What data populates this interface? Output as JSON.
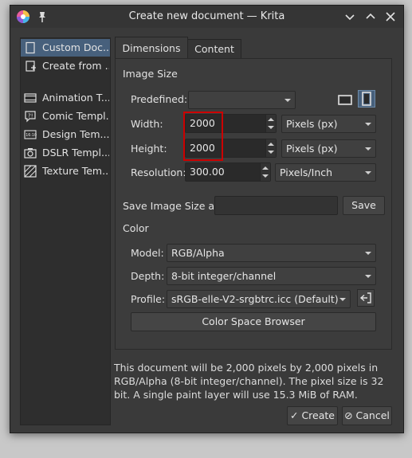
{
  "window": {
    "title": "Create new document — Krita",
    "app_icon": "krita-icon",
    "pin_icon": "pin-icon",
    "controls": [
      "minimize-icon",
      "maximize-icon",
      "close-icon"
    ]
  },
  "sidebar": {
    "items": [
      {
        "label": "Custom Doc...",
        "icon": "document-icon",
        "active": true
      },
      {
        "label": "Create from ...",
        "icon": "new-from-clipboard-icon",
        "active": false
      },
      {
        "label": "Animation T...",
        "icon": "film-strip-icon",
        "active": false
      },
      {
        "label": "Comic Templ...",
        "icon": "speech-bubble-icon",
        "active": false
      },
      {
        "label": "Design Tem...",
        "icon": "display-16-10-icon",
        "active": false
      },
      {
        "label": "DSLR Templ...",
        "icon": "camera-icon",
        "active": false
      },
      {
        "label": "Texture Tem...",
        "icon": "texture-icon",
        "active": false
      }
    ]
  },
  "tabs": [
    {
      "label": "Dimensions",
      "active": true
    },
    {
      "label": "Content",
      "active": false
    }
  ],
  "image_size": {
    "section_title": "Image Size",
    "predefined_label": "Predefined:",
    "predefined_value": "",
    "width_label": "Width:",
    "width_value": "2000",
    "width_unit": "Pixels (px)",
    "height_label": "Height:",
    "height_value": "2000",
    "height_unit": "Pixels (px)",
    "resolution_label": "Resolution:",
    "resolution_value": "300.00",
    "resolution_unit": "Pixels/Inch",
    "save_as_label": "Save Image Size as:",
    "save_as_value": "",
    "save_button": "Save",
    "orientation_icons": [
      "landscape-icon",
      "portrait-icon"
    ]
  },
  "color": {
    "section_title": "Color",
    "model_label": "Model:",
    "model_value": "RGB/Alpha",
    "depth_label": "Depth:",
    "depth_value": "8-bit integer/channel",
    "profile_label": "Profile:",
    "profile_value": "sRGB-elle-V2-srgbtrc.icc (Default)",
    "browser_button": "Color Space Browser"
  },
  "info_text": "This document will be 2,000 pixels by 2,000 pixels in RGB/Alpha (8-bit integer/channel). The pixel size is 32 bit. A single paint layer will use 15.3 MiB of RAM.",
  "buttons": {
    "create": "Create",
    "cancel": "Cancel"
  },
  "colors": {
    "window_bg": "#3a3a3a",
    "selection": "#47607c",
    "highlight_box": "#cc0000"
  }
}
